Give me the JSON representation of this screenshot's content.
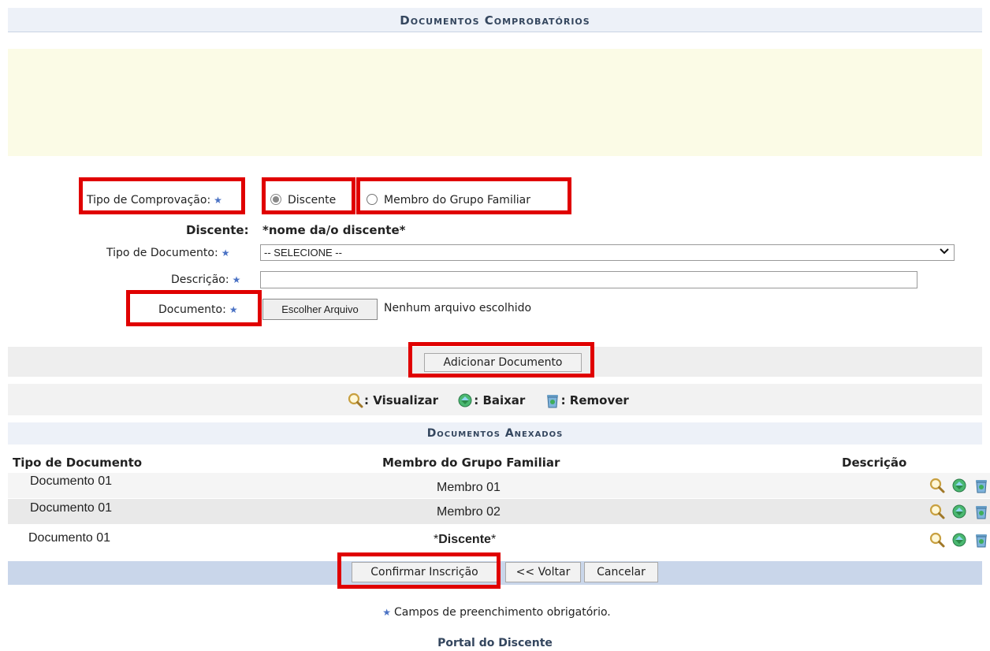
{
  "section_title": "Documentos Comprobatórios",
  "form": {
    "tipo_comprovacao_label": "Tipo de Comprovação:",
    "radio_discente": "Discente",
    "radio_membro": "Membro do Grupo Familiar",
    "discente_label": "Discente:",
    "discente_value": "*nome da/o discente*",
    "tipo_documento_label": "Tipo de Documento:",
    "tipo_documento_value": "-- SELECIONE --",
    "descricao_label": "Descrição:",
    "documento_label": "Documento:",
    "file_button": "Escolher Arquivo",
    "file_status": "Nenhum arquivo escolhido"
  },
  "add_button": "Adicionar Documento",
  "legend": {
    "visualizar": ": Visualizar",
    "baixar": ": Baixar",
    "remover": ": Remover"
  },
  "anexados_title": "Documentos Anexados",
  "table": {
    "headers": [
      "Tipo de Documento",
      "Membro do Grupo Familiar",
      "Descrição"
    ],
    "rows": [
      {
        "tipo": "Documento 01",
        "membro": "Membro 01"
      },
      {
        "tipo": "Documento 01",
        "membro": "Membro 02"
      },
      {
        "tipo": "Documento 01",
        "membro_prefix": "*",
        "membro_bold": "Discente",
        "membro_suffix": "*"
      }
    ]
  },
  "buttons": {
    "confirmar": "Confirmar Inscrição",
    "voltar": "<< Voltar",
    "cancelar": "Cancelar"
  },
  "required_note": "Campos de preenchimento obrigatório.",
  "portal_link": "Portal do Discente",
  "colors": {
    "highlight": "#e00000",
    "required_star": "#4a72c4",
    "header_bg": "#edf1f8"
  }
}
